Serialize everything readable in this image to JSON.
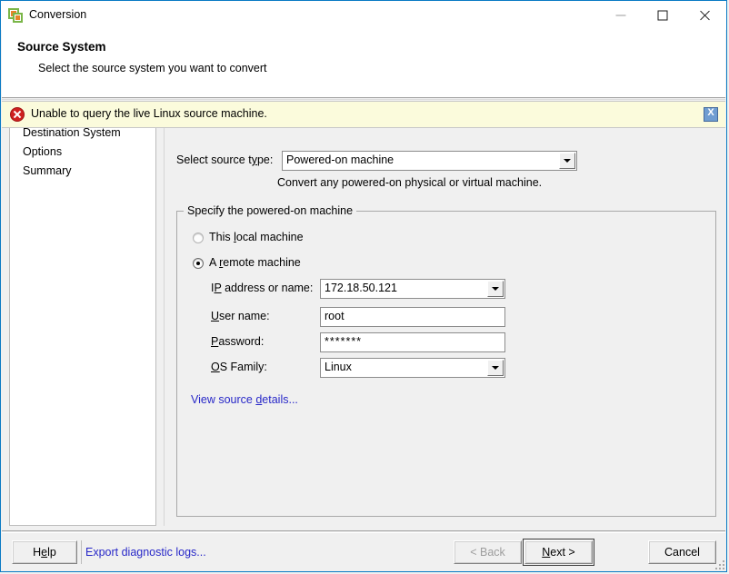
{
  "window": {
    "title": "Conversion",
    "icon": "converter-app-icon",
    "controls": {
      "minimize": "minimize-icon",
      "maximize": "maximize-icon",
      "close": "close-icon"
    }
  },
  "header": {
    "title": "Source System",
    "subtitle": "Select the source system you want to convert"
  },
  "banner": {
    "message": "Unable to query the live Linux source machine.",
    "icon": "error-icon",
    "close_label": "X",
    "background": "#fbfbdc"
  },
  "sidebar": {
    "items": [
      {
        "label": "Destination System"
      },
      {
        "label": "Options"
      },
      {
        "label": "Summary"
      }
    ]
  },
  "main": {
    "source_type_label": "Select source type:",
    "source_type_label_pre": "Select source t",
    "source_type_label_key": "y",
    "source_type_label_post": "pe:",
    "source_type_value": "Powered-on machine",
    "source_type_hint": "Convert any powered-on physical or virtual machine.",
    "group_title": "Specify the powered-on machine",
    "radios": [
      {
        "label_pre": "This ",
        "label_key": "l",
        "label_post": "ocal machine",
        "selected": false
      },
      {
        "label_pre": "A ",
        "label_key": "r",
        "label_post": "emote machine",
        "selected": true
      }
    ],
    "fields": [
      {
        "label_pre": "I",
        "label_key": "P",
        "label_post": " address or name:",
        "value": "172.18.50.121",
        "type": "combo"
      },
      {
        "label_pre": "",
        "label_key": "U",
        "label_post": "ser name:",
        "value": "root",
        "type": "text"
      },
      {
        "label_pre": "",
        "label_key": "P",
        "label_post": "assword:",
        "value": "*******",
        "type": "text"
      },
      {
        "label_pre": "",
        "label_key": "O",
        "label_post": "S Family:",
        "value": "Linux",
        "type": "combo"
      }
    ],
    "view_details_pre": "View source ",
    "view_details_key": "d",
    "view_details_post": "etails..."
  },
  "footer": {
    "help_pre": "H",
    "help_key": "e",
    "help_post": "lp",
    "export_logs_pre": "Export dia",
    "export_logs_key": "g",
    "export_logs_post": "nostic logs...",
    "back_label": "< Back",
    "next_pre": "",
    "next_key": "N",
    "next_post": "ext >",
    "cancel_label": "Cancel"
  }
}
